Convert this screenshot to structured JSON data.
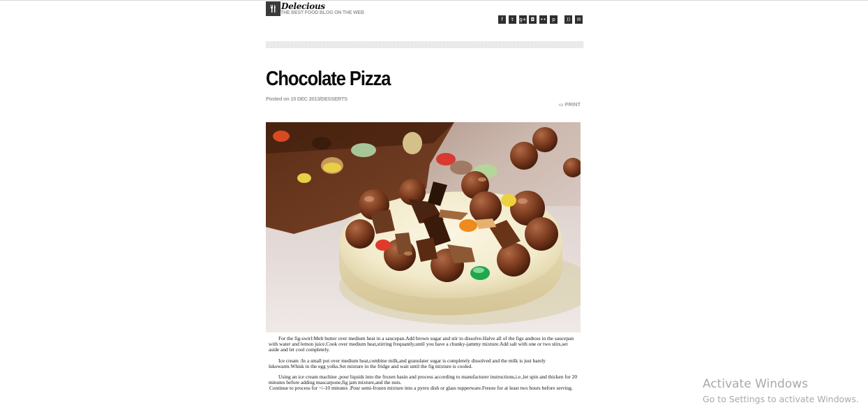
{
  "site": {
    "name": "Delecious",
    "tagline": "THE BEST FOOD BLOG ON THE WEB"
  },
  "social_icons": [
    {
      "name": "facebook-icon",
      "glyph": "f"
    },
    {
      "name": "twitter-icon",
      "glyph": "t"
    },
    {
      "name": "google-plus-icon",
      "glyph": "g+"
    },
    {
      "name": "instagram-icon",
      "glyph": "◘"
    },
    {
      "name": "flickr-icon",
      "glyph": "••"
    },
    {
      "name": "pinterest-icon",
      "glyph": "p"
    },
    {
      "name": "rss-icon",
      "glyph": "))"
    },
    {
      "name": "email-icon",
      "glyph": "✉"
    }
  ],
  "post": {
    "title": "Chocolate Pizza",
    "meta": "Posted on 15 DEC 2013/DESSERTS",
    "print_label": "PRINT",
    "paragraphs": [
      "For the fig-swirl:Melt butter over medium heat in a saucepan.Add brown sugar and stir to dissolve.Halve all of the figs andtoss in the saucepan with water and lemon juice.Cook over medium heat,stirring frequantly,until you have a chunky-jammy mixture.Add salt with one or two stirs,set aside and let cool completely.",
      "Ice cream :In a small pot over medium heat,combine milk,and granulater sugar is completely dissolved and the milk is just barely lukewarm.Whisk in the egg yolks.Set mixture in the fridge and wait until the fig mixture is cooled.",
      "Using an ice cream machine ,pour liquids into the frozen basin and process according to manufacturer instructions,i.e.,let spin and thicken for 20 minutes before adding mascarpone,fig jam mixture,and the nuts.",
      "Continue to process for =/-10 minutes .Pour semi-frozen mixture into a pyrex dish or glass tupperware.Freeze for at least two hours before serving."
    ]
  },
  "os_watermark": {
    "title": "Activate Windows",
    "subtitle": "Go to Settings to activate Windows."
  }
}
